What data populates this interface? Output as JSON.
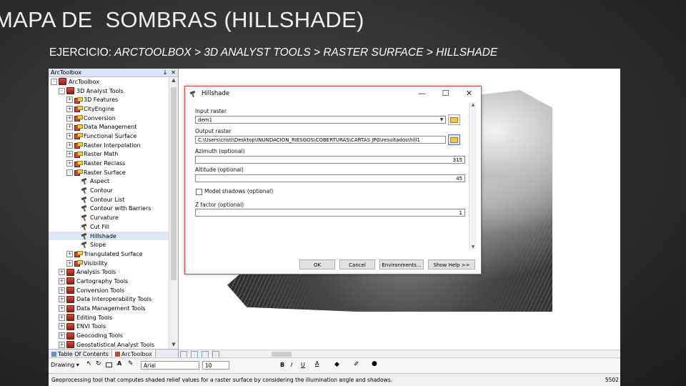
{
  "slide": {
    "title": "MAPA DE  SOMBRAS (HILLSHADE)",
    "subtitle_prefix": "EJERCICIO: ",
    "subtitle_path": "ARCTOOLBOX > 3D ANALYST TOOLS > RASTER SURFACE > HILLSHADE"
  },
  "toolbox": {
    "title": "ArcToolbox",
    "header_controls": [
      "↓",
      "✕"
    ],
    "items": [
      {
        "label": "ArcToolbox",
        "indent": 0,
        "expander": "-",
        "icon": "toolbox-icon"
      },
      {
        "label": "3D Analyst Tools",
        "indent": 1,
        "expander": "-",
        "icon": "toolbox-icon"
      },
      {
        "label": "3D Features",
        "indent": 2,
        "expander": "+",
        "icon": "toolset-icon"
      },
      {
        "label": "CityEngine",
        "indent": 2,
        "expander": "+",
        "icon": "toolset-icon"
      },
      {
        "label": "Conversion",
        "indent": 2,
        "expander": "+",
        "icon": "toolset-icon"
      },
      {
        "label": "Data Management",
        "indent": 2,
        "expander": "+",
        "icon": "toolset-icon"
      },
      {
        "label": "Functional Surface",
        "indent": 2,
        "expander": "+",
        "icon": "toolset-icon"
      },
      {
        "label": "Raster Interpolation",
        "indent": 2,
        "expander": "+",
        "icon": "toolset-icon"
      },
      {
        "label": "Raster Math",
        "indent": 2,
        "expander": "+",
        "icon": "toolset-icon"
      },
      {
        "label": "Raster Reclass",
        "indent": 2,
        "expander": "+",
        "icon": "toolset-icon"
      },
      {
        "label": "Raster Surface",
        "indent": 2,
        "expander": "-",
        "icon": "toolset-icon"
      },
      {
        "label": "Aspect",
        "indent": 3,
        "expander": "",
        "icon": "tool-hammer-icon"
      },
      {
        "label": "Contour",
        "indent": 3,
        "expander": "",
        "icon": "tool-hammer-icon"
      },
      {
        "label": "Contour List",
        "indent": 3,
        "expander": "",
        "icon": "tool-hammer-icon"
      },
      {
        "label": "Contour with Barriers",
        "indent": 3,
        "expander": "",
        "icon": "tool-hammer-icon"
      },
      {
        "label": "Curvature",
        "indent": 3,
        "expander": "",
        "icon": "tool-hammer-icon"
      },
      {
        "label": "Cut Fill",
        "indent": 3,
        "expander": "",
        "icon": "tool-hammer-icon"
      },
      {
        "label": "Hillshade",
        "indent": 3,
        "expander": "",
        "icon": "tool-hammer-icon",
        "selected": true
      },
      {
        "label": "Slope",
        "indent": 3,
        "expander": "",
        "icon": "tool-hammer-icon"
      },
      {
        "label": "Triangulated Surface",
        "indent": 2,
        "expander": "+",
        "icon": "toolset-icon"
      },
      {
        "label": "Visibility",
        "indent": 2,
        "expander": "+",
        "icon": "toolset-icon"
      },
      {
        "label": "Analysis Tools",
        "indent": 1,
        "expander": "+",
        "icon": "toolbox-icon"
      },
      {
        "label": "Cartography Tools",
        "indent": 1,
        "expander": "+",
        "icon": "toolbox-icon"
      },
      {
        "label": "Conversion Tools",
        "indent": 1,
        "expander": "+",
        "icon": "toolbox-icon"
      },
      {
        "label": "Data Interoperability Tools",
        "indent": 1,
        "expander": "+",
        "icon": "toolbox-icon"
      },
      {
        "label": "Data Management Tools",
        "indent": 1,
        "expander": "+",
        "icon": "toolbox-icon"
      },
      {
        "label": "Editing Tools",
        "indent": 1,
        "expander": "+",
        "icon": "toolbox-icon"
      },
      {
        "label": "ENVI Tools",
        "indent": 1,
        "expander": "+",
        "icon": "toolbox-icon"
      },
      {
        "label": "Geocoding Tools",
        "indent": 1,
        "expander": "+",
        "icon": "toolbox-icon"
      },
      {
        "label": "Geostatistical Analyst Tools",
        "indent": 1,
        "expander": "+",
        "icon": "toolbox-icon"
      }
    ],
    "tabs": [
      {
        "label": "Table Of Contents",
        "active": false
      },
      {
        "label": "ArcToolbox",
        "active": true
      }
    ]
  },
  "dialog": {
    "title": "Hillshade",
    "window_controls": [
      "—",
      "☐",
      "✕"
    ],
    "fields": {
      "input_raster_label": "Input raster",
      "input_raster_value": "dem1",
      "output_raster_label": "Output raster",
      "output_raster_value": "C:\\Users\\cristi\\Desktop\\INUNDACION_RIESGOS\\COBERTURAS\\CARTAS JPG\\resultados\\hill1",
      "azimuth_label": "Azimuth (optional)",
      "azimuth_value": "315",
      "altitude_label": "Altitude (optional)",
      "altitude_value": "45",
      "model_shadows_label": "Model shadows (optional)",
      "zfactor_label": "Z factor (optional)",
      "zfactor_value": "1"
    },
    "buttons": {
      "ok": "OK",
      "cancel": "Cancel",
      "environments": "Environments...",
      "show_help": "Show Help >>"
    }
  },
  "drawing_toolbar": {
    "drawing_label": "Drawing ▾",
    "font_name": "Arial",
    "font_size": "10",
    "bold": "B",
    "italic": "I",
    "underline": "U"
  },
  "status": {
    "message": "Geoprocessing tool that computes shaded relief values for a raster surface by considering the illumination angle and shadows.",
    "coordinate": "5502"
  },
  "colors": {
    "dialog_border": "#e0463a",
    "selected_bg": "#dde8f6",
    "pane_header": "#dbe4f1"
  }
}
